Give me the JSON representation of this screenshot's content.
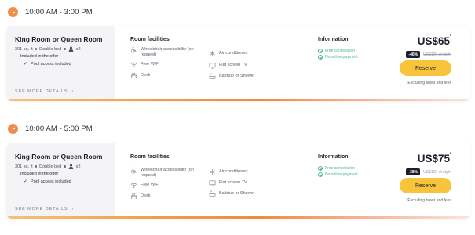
{
  "slots": [
    {
      "time": "10:00 AM - 3:00 PM",
      "room": {
        "name": "King Room or Queen Room",
        "size": "301 sq. ft",
        "bed": "Double bed",
        "guests": "x2",
        "offer_title": "Included in the offer",
        "offer_item": "Pool access included",
        "see_more": "SEE MORE DETAILS"
      },
      "facilities": {
        "title": "Room facilities",
        "items": [
          {
            "label": "Wheelchair accessibility (on request)",
            "icon": "wheelchair-icon"
          },
          {
            "label": "Free WiFi",
            "icon": "wifi-icon"
          },
          {
            "label": "Desk",
            "icon": "desk-icon"
          },
          {
            "label": "Air conditioned",
            "icon": "snowflake-icon"
          },
          {
            "label": "Flat screen TV",
            "icon": "tv-icon"
          },
          {
            "label": "Bathtub or Shower",
            "icon": "bathtub-icon"
          }
        ]
      },
      "info": {
        "title": "Information",
        "lines": [
          "Free cancellation",
          "No online payment"
        ]
      },
      "pricing": {
        "price": "US$65",
        "price_mark": "*",
        "discount": "-46%",
        "old_price": "US$120 at night",
        "reserve": "Reserve",
        "tax_note": "*Excluding taxes and fees"
      }
    },
    {
      "time": "10:00 AM - 5:00 PM",
      "room": {
        "name": "King Room or Queen Room",
        "size": "301 sq. ft",
        "bed": "Double bed",
        "guests": "x2",
        "offer_title": "Included in the offer",
        "offer_item": "Pool access included",
        "see_more": "SEE MORE DETAILS"
      },
      "facilities": {
        "title": "Room facilities",
        "items": [
          {
            "label": "Wheelchair accessibility (on request)",
            "icon": "wheelchair-icon"
          },
          {
            "label": "Free WiFi",
            "icon": "wifi-icon"
          },
          {
            "label": "Desk",
            "icon": "desk-icon"
          },
          {
            "label": "Air conditioned",
            "icon": "snowflake-icon"
          },
          {
            "label": "Flat screen TV",
            "icon": "tv-icon"
          },
          {
            "label": "Bathtub or Shower",
            "icon": "bathtub-icon"
          }
        ]
      },
      "info": {
        "title": "Information",
        "lines": [
          "Free cancellation",
          "No online payment"
        ]
      },
      "pricing": {
        "price": "US$75",
        "price_mark": "*",
        "discount": "-38%",
        "old_price": "US$120 at night",
        "reserve": "Reserve",
        "tax_note": "*Excluding taxes and fees"
      }
    }
  ],
  "colors": {
    "accent": "#ef8f4c",
    "reserve": "#f8c43c",
    "info_green": "#48b58a",
    "card_left_bg": "#f4f4f6"
  }
}
